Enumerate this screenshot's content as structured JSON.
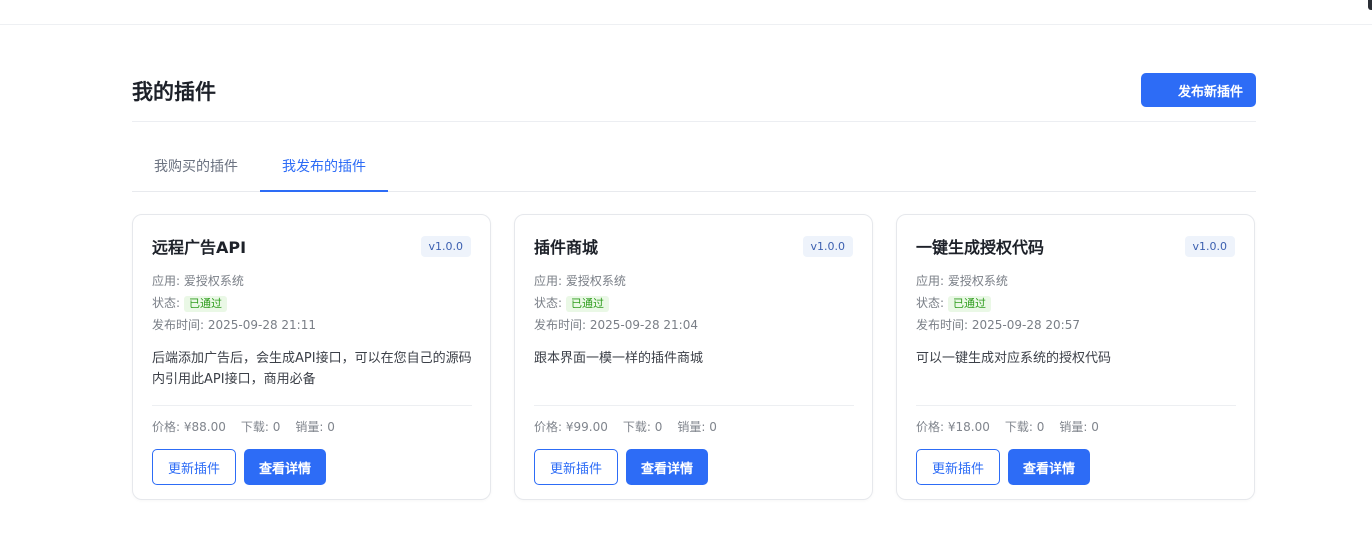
{
  "header": {
    "title": "我的插件",
    "publish_button": "发布新插件"
  },
  "tabs": [
    {
      "label": "我购买的插件",
      "active": false
    },
    {
      "label": "我发布的插件",
      "active": true
    }
  ],
  "labels": {
    "app_prefix": "应用: ",
    "status_prefix": "状态:",
    "time_prefix": "发布时间: ",
    "price_prefix": "价格: ",
    "downloads_prefix": "下载: ",
    "sales_prefix": "销量: ",
    "update_button": "更新插件",
    "detail_button": "查看详情"
  },
  "plugins": [
    {
      "title": "远程广告API",
      "version": "v1.0.0",
      "app": "爱授权系统",
      "status": "已通过",
      "published": "2025-09-28 21:11",
      "description": "后端添加广告后，会生成API接口，可以在您自己的源码内引用此API接口，商用必备",
      "price": "¥88.00",
      "downloads": "0",
      "sales": "0"
    },
    {
      "title": "插件商城",
      "version": "v1.0.0",
      "app": "爱授权系统",
      "status": "已通过",
      "published": "2025-09-28 21:04",
      "description": "跟本界面一模一样的插件商城",
      "price": "¥99.00",
      "downloads": "0",
      "sales": "0"
    },
    {
      "title": "一键生成授权代码",
      "version": "v1.0.0",
      "app": "爱授权系统",
      "status": "已通过",
      "published": "2025-09-28 20:57",
      "description": "可以一键生成对应系统的授权代码",
      "price": "¥18.00",
      "downloads": "0",
      "sales": "0"
    }
  ],
  "colors": {
    "primary": "#2d6cf6",
    "status_green": "#2f9d1e",
    "status_bg": "#eaf8e6"
  }
}
